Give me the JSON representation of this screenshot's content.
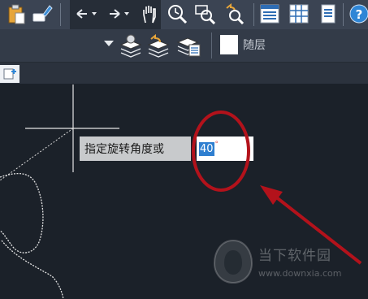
{
  "toolbar_top": {
    "icons": [
      "paste-icon",
      "match-properties-icon",
      "undo-icon",
      "redo-icon",
      "pan-icon",
      "zoom-realtime-icon",
      "zoom-window-icon",
      "zoom-previous-icon",
      "properties-palette-icon",
      "design-center-icon",
      "tool-palette-icon",
      "help-icon"
    ]
  },
  "toolbar_layer": {
    "current_layer_label": "随层",
    "swatch_color": "#ffffff"
  },
  "command": {
    "prompt": "指定旋转角度或",
    "input_value": "40",
    "degree_symbol": "°"
  },
  "annotation": {
    "circle_color": "#b3121b",
    "arrow_color": "#b3121b"
  },
  "watermark": {
    "brand": "当下软件园",
    "url": "www.downxia.com"
  }
}
